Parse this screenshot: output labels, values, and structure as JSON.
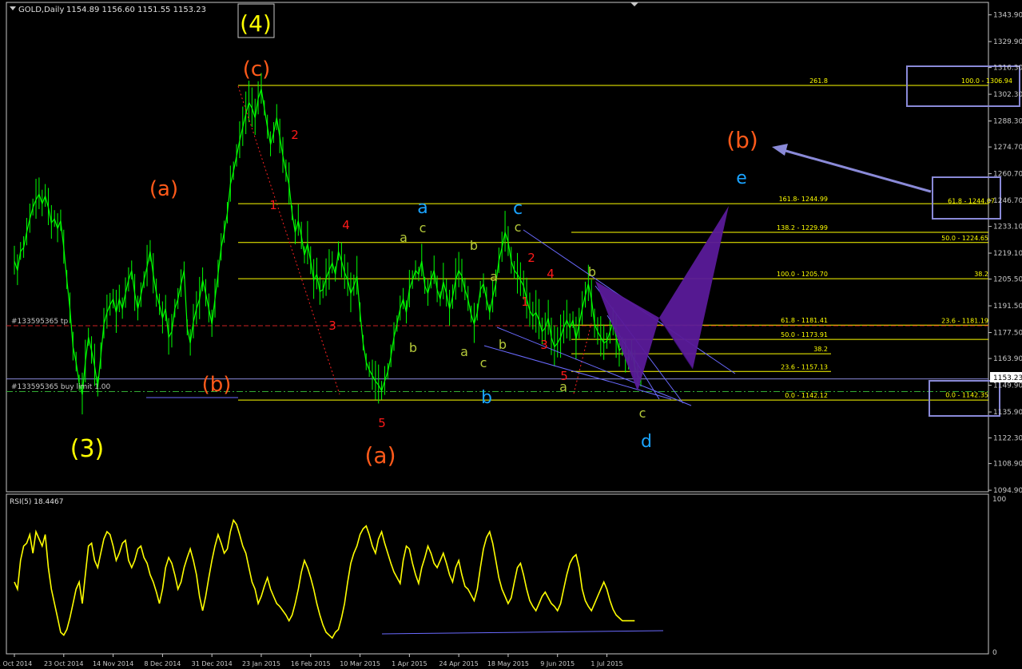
{
  "header": {
    "symbol": "GOLD,Daily",
    "ohlc": "1154.89 1156.60 1151.55 1153.23",
    "current_price": "1153.23",
    "tp_label": "#133595365 tp",
    "buy_limit_label": "#133595365 buy limit 1.00"
  },
  "rsi": {
    "title": "RSI(5) 18.4467",
    "scale_top": "100",
    "scale_bottom": "0"
  },
  "colors": {
    "background": "#000000",
    "price_line": "#00ff00",
    "rsi_line": "#ffff00",
    "fib_line": "#ffff00",
    "wave_orange": "#ff5a1a",
    "wave_yellow": "#ffff00",
    "wave_cyan": "#1aa3ff",
    "wave_red": "#ff1a1a",
    "wave_olive": "#b5c93a",
    "pattern_fill": "#5a1a99",
    "highlight_box": "#8a8ad8"
  },
  "chart_data": [
    {
      "type": "line",
      "title": "GOLD,Daily",
      "ylim": [
        1087,
        1351
      ],
      "y_ticks": [
        1094.9,
        1108.9,
        1122.3,
        1135.9,
        1149.9,
        1163.9,
        1177.5,
        1191.5,
        1205.5,
        1219.1,
        1233.1,
        1246.7,
        1260.7,
        1274.7,
        1288.3,
        1302.3,
        1316.3,
        1329.9,
        1343.9
      ],
      "y_tick_labels": [
        "1094.90",
        "1108.90",
        "1122.30",
        "1135.90",
        "1149.90",
        "1163.90",
        "1177.50",
        "1191.50",
        "1205.50",
        "1219.10",
        "1233.10",
        "1246.70",
        "1260.70",
        "1274.70",
        "1288.30",
        "1302.30",
        "1316.30",
        "1329.90",
        "1343.90"
      ],
      "x_tick_labels": [
        "1 Oct 2014",
        "23 Oct 2014",
        "14 Nov 2014",
        "8 Dec 2014",
        "31 Dec 2014",
        "23 Jan 2015",
        "16 Feb 2015",
        "10 Mar 2015",
        "1 Apr 2015",
        "24 Apr 2015",
        "18 May 2015",
        "9 Jun 2015",
        "1 Jul 2015"
      ],
      "x_tick_index": [
        0,
        16,
        32,
        48,
        64,
        80,
        96,
        112,
        128,
        144,
        160,
        176,
        192
      ],
      "series": [
        {
          "values": [
            1215,
            1210,
            1220,
            1222,
            1230,
            1237,
            1243,
            1247,
            1250,
            1245,
            1249,
            1243,
            1235,
            1237,
            1232,
            1236,
            1222,
            1205,
            1190,
            1170,
            1162,
            1151,
            1145,
            1162,
            1175,
            1168,
            1160,
            1149,
            1165,
            1182,
            1188,
            1192,
            1195,
            1188,
            1195,
            1190,
            1198,
            1205,
            1210,
            1198,
            1190,
            1197,
            1205,
            1212,
            1220,
            1208,
            1198,
            1192,
            1185,
            1190,
            1175,
            1178,
            1190,
            1195,
            1203,
            1210,
            1180,
            1172,
            1183,
            1190,
            1195,
            1205,
            1198,
            1190,
            1182,
            1195,
            1208,
            1222,
            1230,
            1240,
            1255,
            1262,
            1270,
            1278,
            1285,
            1292,
            1298,
            1295,
            1290,
            1300,
            1305,
            1295,
            1285,
            1276,
            1282,
            1290,
            1280,
            1270,
            1262,
            1255,
            1240,
            1230,
            1236,
            1228,
            1218,
            1224,
            1215,
            1205,
            1208,
            1199,
            1200,
            1206,
            1210,
            1214,
            1208,
            1220,
            1215,
            1209,
            1205,
            1198,
            1202,
            1207,
            1188,
            1172,
            1162,
            1158,
            1155,
            1152,
            1150,
            1147,
            1152,
            1157,
            1165,
            1175,
            1182,
            1190,
            1195,
            1188,
            1200,
            1205,
            1210,
            1208,
            1215,
            1202,
            1198,
            1205,
            1210,
            1200,
            1195,
            1204,
            1198,
            1190,
            1196,
            1205,
            1210,
            1207,
            1200,
            1195,
            1187,
            1182,
            1188,
            1200,
            1203,
            1195,
            1188,
            1196,
            1203,
            1215,
            1222,
            1230,
            1225,
            1215,
            1210,
            1208,
            1205,
            1202,
            1195,
            1189,
            1186,
            1188,
            1184,
            1178,
            1180,
            1185,
            1175,
            1170,
            1172,
            1175,
            1180,
            1184,
            1180,
            1184,
            1174,
            1182,
            1190,
            1197,
            1203,
            1195,
            1182,
            1178,
            1175,
            1172,
            1173,
            1178,
            1183,
            1175,
            1168,
            1170,
            1165,
            1163,
            1168,
            1160,
            1155,
            1153
          ]
        }
      ],
      "fib_levels": [
        {
          "label": "261.8",
          "price": 1306.94
        },
        {
          "label": "100.0 - 1306.94",
          "price": 1306.94
        },
        {
          "label": "161.8- 1244.99",
          "price": 1244.99
        },
        {
          "label": "61.8 - 1244.07",
          "price": 1244.07
        },
        {
          "label": "138.2 - 1229.99",
          "price": 1229.99
        },
        {
          "label": "50.0 - 1224.65",
          "price": 1224.65
        },
        {
          "label": "100.0 - 1205.70",
          "price": 1205.7
        },
        {
          "label": "38.2",
          "price": 1205.7
        },
        {
          "label": "61.8 - 1181.41",
          "price": 1181.41
        },
        {
          "label": "23.6 - 1181.19",
          "price": 1181.19
        },
        {
          "label": "50.0 - 1173.91",
          "price": 1173.91
        },
        {
          "label": "38.2",
          "price": 1166.4
        },
        {
          "label": "23.6 - 1157.13",
          "price": 1157.13
        },
        {
          "label": "0.0 - 1142.12",
          "price": 1142.12
        },
        {
          "label": "0.0 - 1142.35",
          "price": 1142.35
        }
      ],
      "wave_labels": [
        {
          "text": "(4)",
          "color": "yellow"
        },
        {
          "text": "(c)",
          "color": "orange"
        },
        {
          "text": "(a)",
          "color": "orange"
        },
        {
          "text": "(b)",
          "color": "orange"
        },
        {
          "text": "(3)",
          "color": "yellow"
        },
        {
          "text": "(a)",
          "color": "orange"
        },
        {
          "text": "(b)",
          "color": "orange"
        },
        {
          "text": "e",
          "color": "cyan"
        },
        {
          "text": "a",
          "color": "cyan"
        },
        {
          "text": "c",
          "color": "cyan"
        },
        {
          "text": "b",
          "color": "cyan"
        },
        {
          "text": "d",
          "color": "cyan"
        },
        {
          "text": "2",
          "color": "red"
        },
        {
          "text": "1",
          "color": "red"
        },
        {
          "text": "4",
          "color": "red"
        },
        {
          "text": "3",
          "color": "red"
        },
        {
          "text": "5",
          "color": "red"
        },
        {
          "text": "2",
          "color": "red"
        },
        {
          "text": "4",
          "color": "red"
        },
        {
          "text": "1",
          "color": "red"
        },
        {
          "text": "3",
          "color": "red"
        },
        {
          "text": "5",
          "color": "red"
        },
        {
          "text": "a",
          "color": "olive"
        },
        {
          "text": "c",
          "color": "olive"
        },
        {
          "text": "b",
          "color": "olive"
        },
        {
          "text": "a",
          "color": "olive"
        },
        {
          "text": "c",
          "color": "olive"
        },
        {
          "text": "b",
          "color": "olive"
        },
        {
          "text": "b",
          "color": "olive"
        },
        {
          "text": "a",
          "color": "olive"
        },
        {
          "text": "c",
          "color": "olive"
        },
        {
          "text": "b",
          "color": "olive"
        },
        {
          "text": "a",
          "color": "olive"
        },
        {
          "text": "c",
          "color": "olive"
        }
      ]
    },
    {
      "type": "line",
      "title": "RSI(5) 18.4467",
      "ylim": [
        0,
        100
      ],
      "y_tick_labels": [
        "100",
        "0"
      ],
      "series": [
        {
          "values": [
            45,
            40,
            60,
            70,
            72,
            78,
            65,
            80,
            75,
            70,
            78,
            55,
            40,
            30,
            20,
            10,
            8,
            12,
            20,
            30,
            40,
            45,
            30,
            50,
            70,
            72,
            60,
            55,
            65,
            75,
            80,
            78,
            70,
            60,
            65,
            72,
            74,
            60,
            55,
            60,
            68,
            70,
            62,
            58,
            50,
            45,
            38,
            30,
            40,
            55,
            62,
            58,
            50,
            40,
            45,
            55,
            62,
            68,
            60,
            50,
            35,
            25,
            35,
            48,
            60,
            70,
            78,
            72,
            65,
            68,
            80,
            88,
            85,
            78,
            70,
            65,
            55,
            45,
            40,
            30,
            35,
            42,
            48,
            40,
            35,
            30,
            28,
            25,
            22,
            18,
            22,
            30,
            40,
            52,
            60,
            55,
            48,
            40,
            30,
            22,
            15,
            10,
            8,
            6,
            10,
            12,
            20,
            30,
            45,
            58,
            65,
            70,
            78,
            82,
            84,
            78,
            70,
            65,
            75,
            80,
            72,
            65,
            58,
            52,
            48,
            44,
            60,
            70,
            68,
            58,
            50,
            44,
            55,
            62,
            70,
            65,
            58,
            55,
            60,
            65,
            58,
            50,
            45,
            55,
            60,
            50,
            42,
            40,
            36,
            32,
            40,
            55,
            68,
            76,
            80,
            72,
            60,
            48,
            40,
            35,
            30,
            34,
            45,
            55,
            58,
            50,
            40,
            32,
            28,
            25,
            30,
            35,
            38,
            34,
            30,
            28,
            25,
            30,
            40,
            50,
            58,
            62,
            64,
            55,
            40,
            32,
            28,
            25,
            30,
            35,
            40,
            45,
            40,
            32,
            26,
            22,
            20,
            18,
            18,
            18,
            18,
            18
          ]
        }
      ]
    }
  ]
}
